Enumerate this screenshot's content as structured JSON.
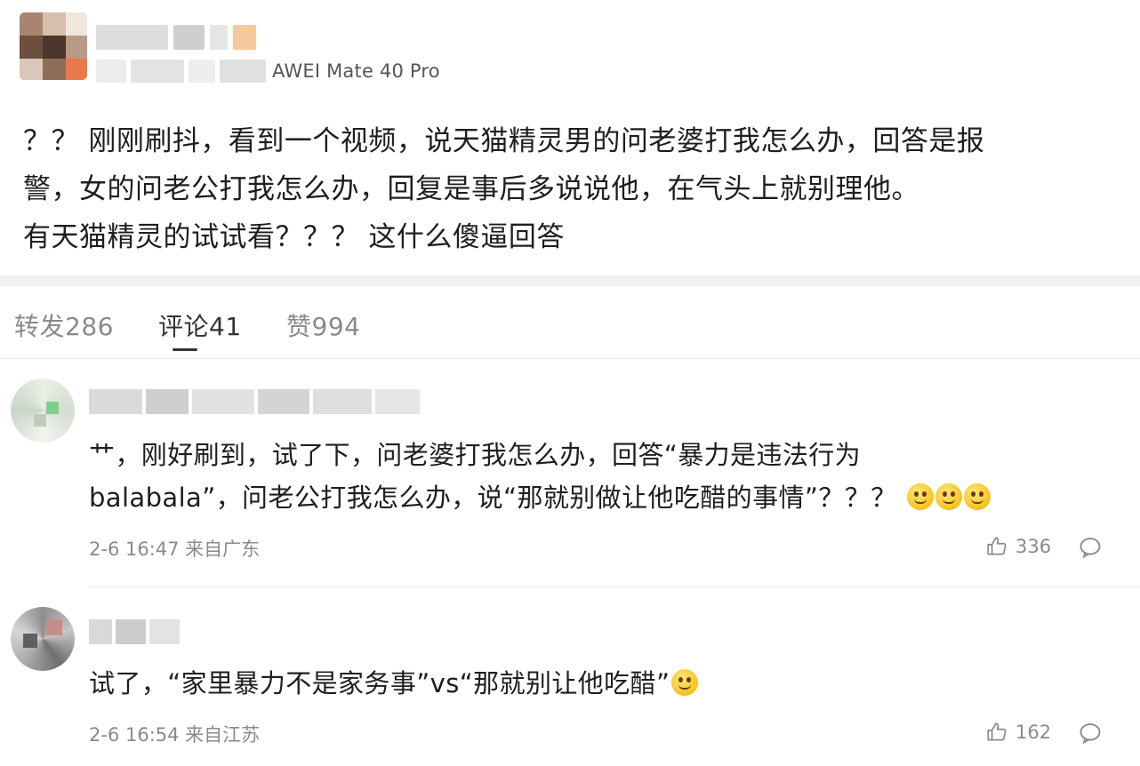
{
  "post": {
    "device": "AWEI Mate 40 Pro",
    "text_lines": [
      "？？ 刚刚刷抖，看到一个视频，说天猫精灵男的问老婆打我怎么办，回答是报",
      "警，女的问老公打我怎么办，回复是事后多说说他，在气头上就别理他。",
      "有天猫精灵的试试看？？？ 这什么傻逼回答"
    ]
  },
  "tabs": [
    {
      "label": "转发286",
      "active": false
    },
    {
      "label": "评论41",
      "active": true
    },
    {
      "label": "赞994",
      "active": false
    }
  ],
  "comments": [
    {
      "text_lines": [
        "艹，刚好刷到，试了下，问老婆打我怎么办，回答“暴力是违法行为",
        "balabala”，问老公打我怎么办，说“那就别做让他吃醋的事情”？？？"
      ],
      "emoji": [
        "grin-emoji",
        "grin-emoji",
        "grin-emoji"
      ],
      "time": "2-6 16:47 来自广东",
      "likes": "336"
    },
    {
      "text_lines": [
        "试了，“家里暴力不是家务事”vs“那就别让他吃醋”"
      ],
      "emoji": [
        "smile-emoji"
      ],
      "time": "2-6 16:54 来自江苏",
      "likes": "162"
    }
  ],
  "colors": {
    "text": "#1e1e1e",
    "muted": "#8a8a8a",
    "divider": "#ececec",
    "band": "#f2f2f2",
    "emoji": "#f7c21b"
  }
}
